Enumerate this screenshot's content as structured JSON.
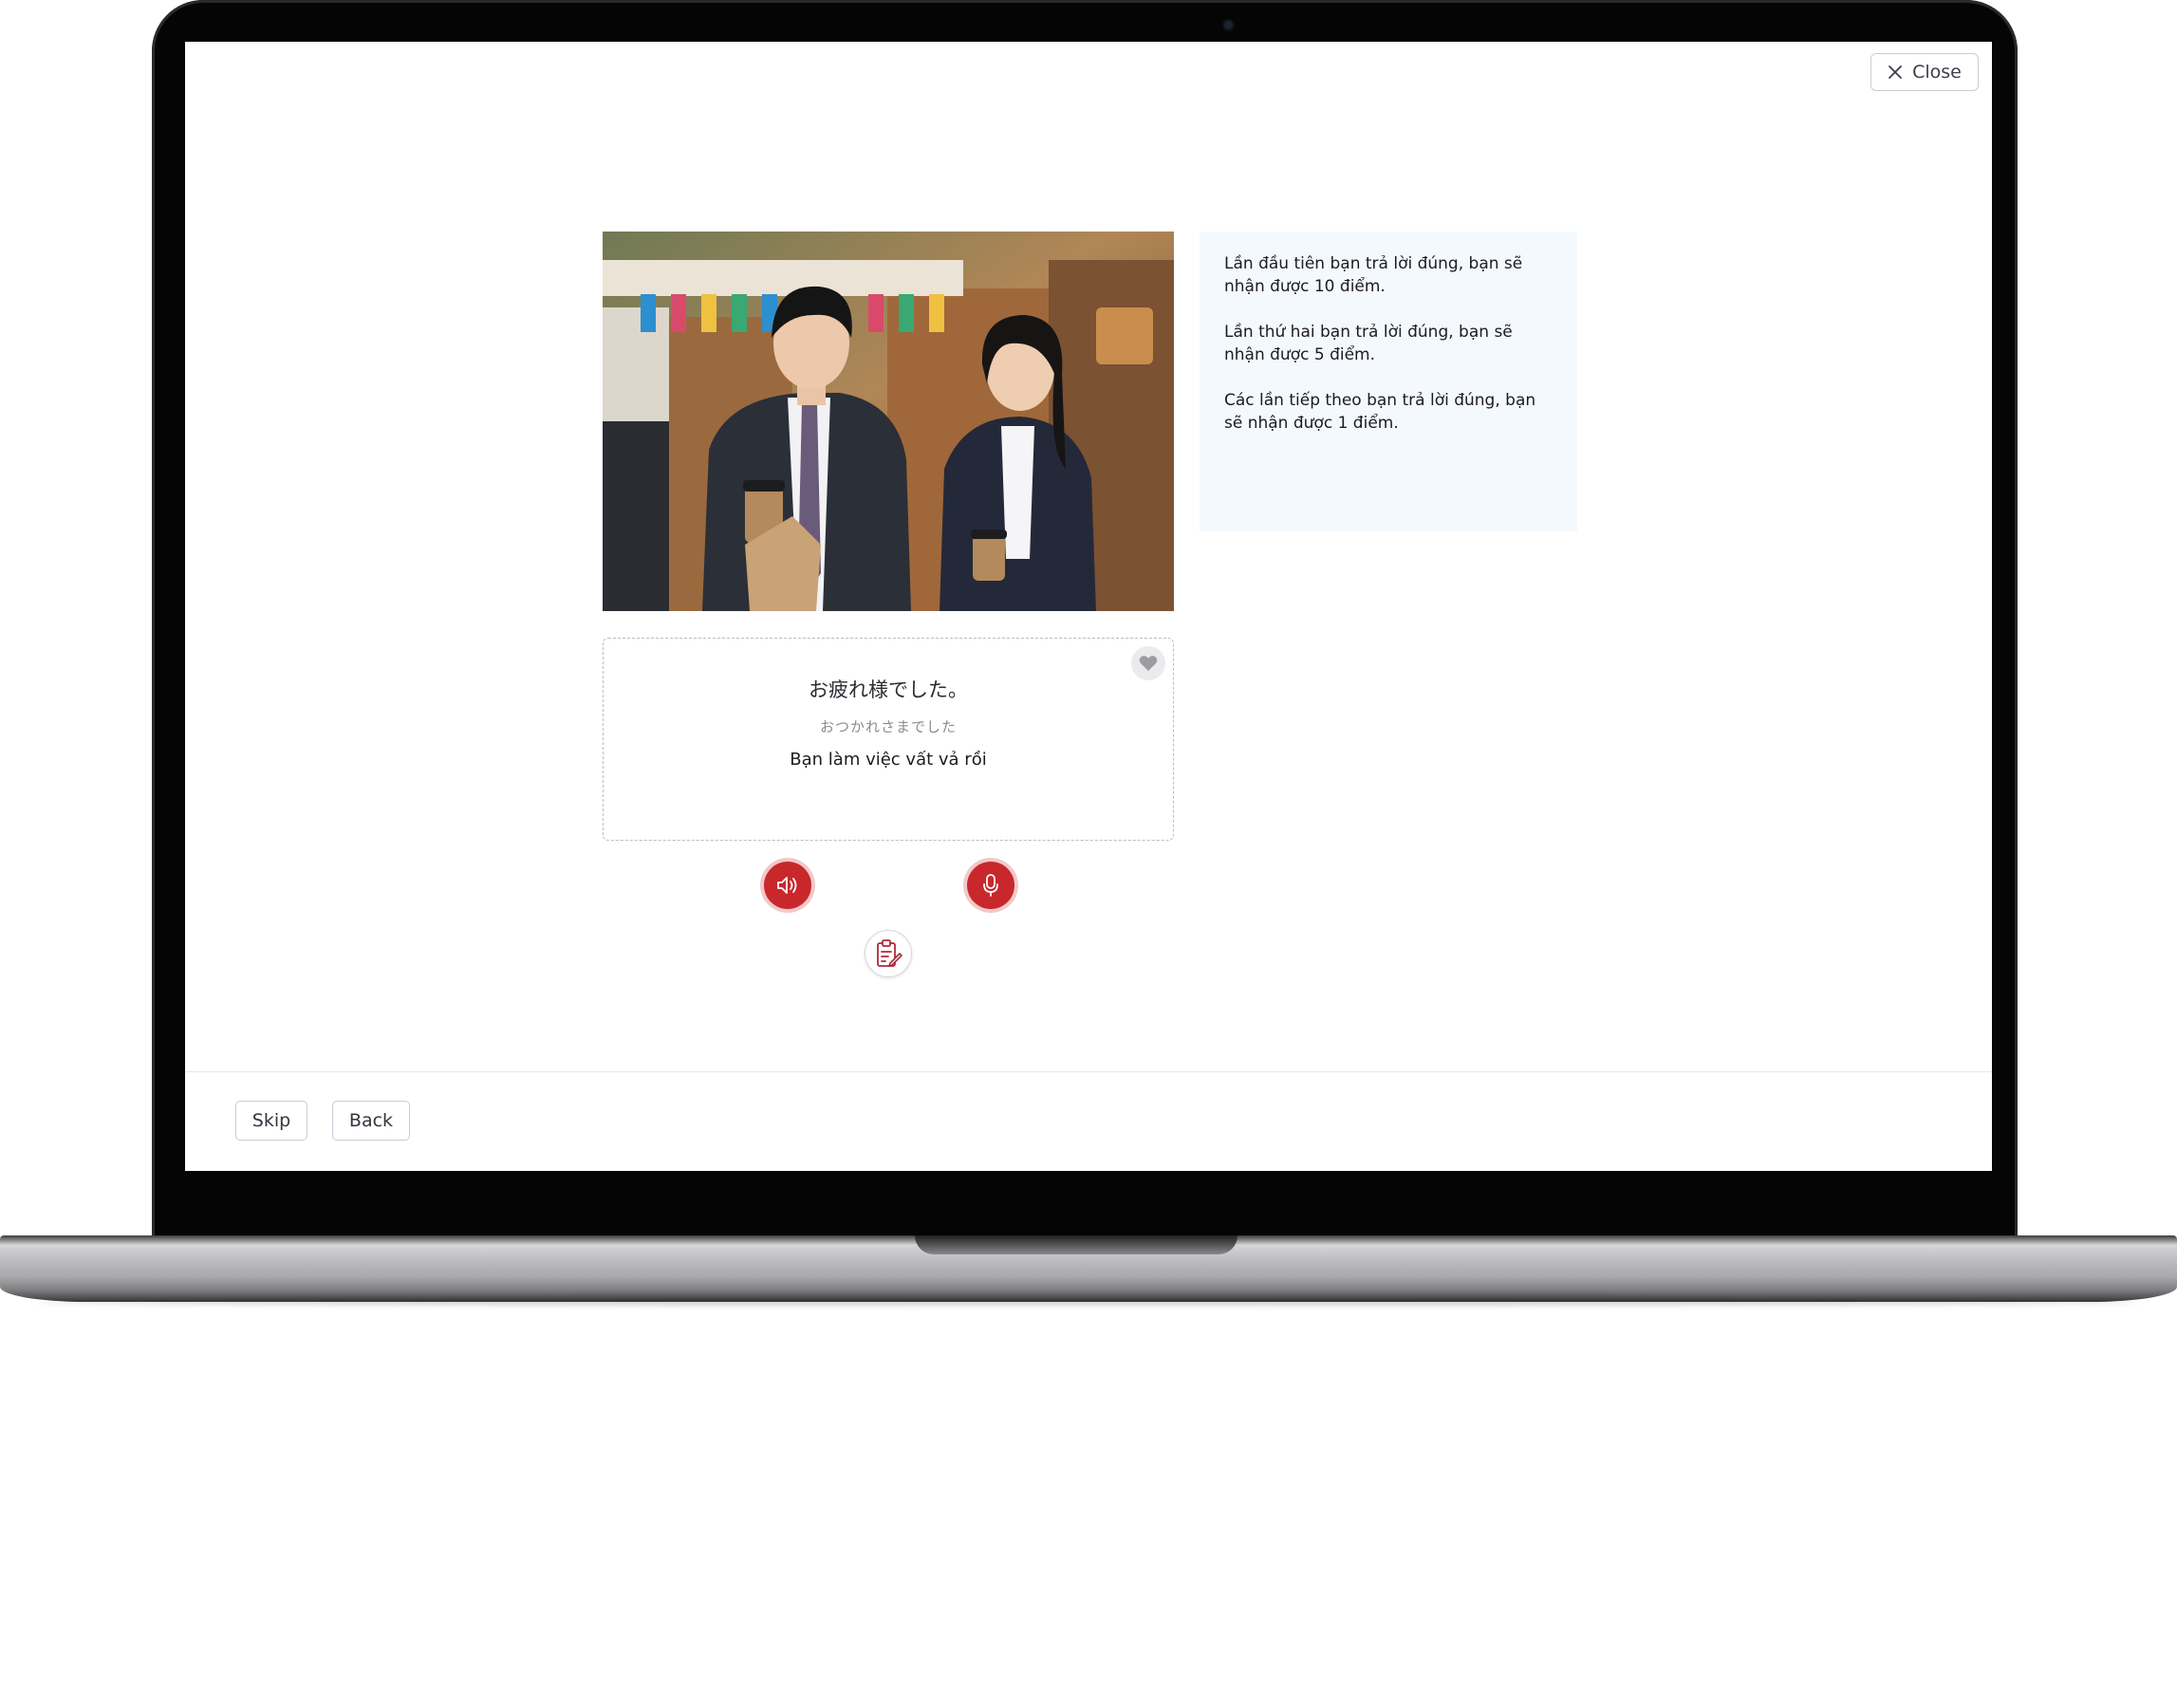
{
  "window": {
    "close_label": "Close"
  },
  "lesson": {
    "image_label": "Two office workers holding coffee cups at a street market",
    "info": [
      "Lần đầu tiên bạn trả lời đúng, bạn sẽ nhận được 10 điểm.",
      "Lần thứ hai bạn trả lời đúng, bạn sẽ nhận được 5 điểm.",
      "Các lần tiếp theo bạn trả lời đúng, bạn sẽ nhận được 1 điểm."
    ],
    "card": {
      "kanji": "お疲れ様でした。",
      "kana": "おつかれさまでした",
      "meaning": "Bạn làm việc vất vả rồi"
    }
  },
  "footer": {
    "skip_label": "Skip",
    "back_label": "Back"
  },
  "colors": {
    "accent_red": "#c8282c",
    "info_bg": "#f4f9fd"
  },
  "icons": [
    "close-icon",
    "heart-icon",
    "speaker-icon",
    "microphone-icon",
    "clipboard-edit-icon"
  ]
}
